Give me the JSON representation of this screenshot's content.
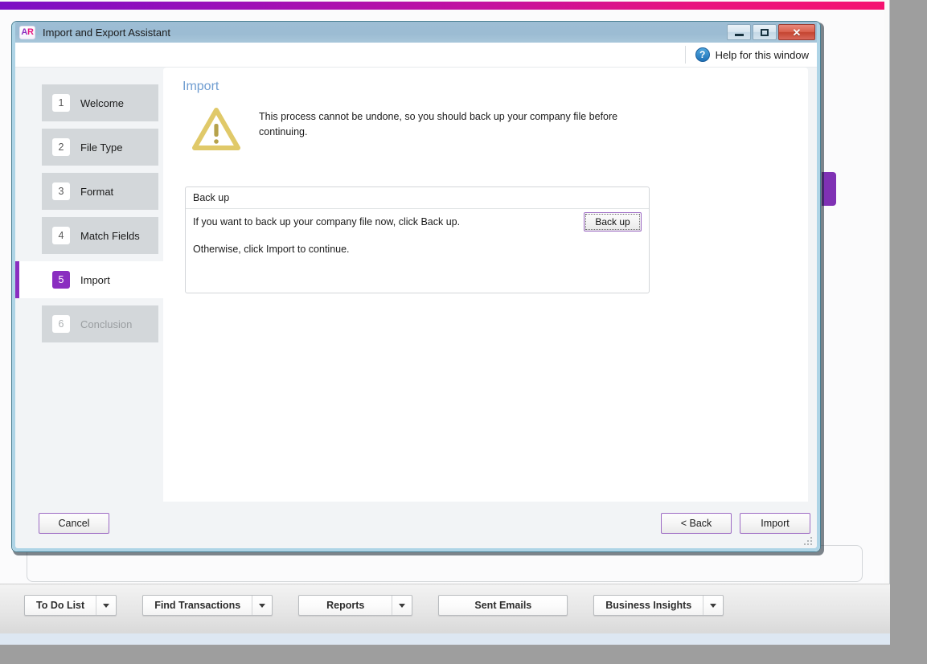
{
  "brand": {
    "gradient_start": "#7b0ec4",
    "gradient_end": "#f51271",
    "accent_purple": "#8a2ec0",
    "accent_pink": "#e5177f"
  },
  "dialog": {
    "logo": {
      "first": "A",
      "second": "R",
      "icon_name": "ar-logo-icon"
    },
    "title": "Import and Export Assistant",
    "window_controls": {
      "minimize": "minimize-icon",
      "maximize": "maximize-icon",
      "close": "✕"
    },
    "help": {
      "icon_glyph": "?",
      "label": "Help for this window"
    },
    "steps": [
      {
        "number": "1",
        "label": "Welcome",
        "state": "available"
      },
      {
        "number": "2",
        "label": "File Type",
        "state": "available"
      },
      {
        "number": "3",
        "label": "Format",
        "state": "available"
      },
      {
        "number": "4",
        "label": "Match Fields",
        "state": "available"
      },
      {
        "number": "5",
        "label": "Import",
        "state": "active"
      },
      {
        "number": "6",
        "label": "Conclusion",
        "state": "disabled"
      }
    ],
    "main": {
      "title": "Import",
      "warning": {
        "icon_name": "warning-triangle-icon",
        "icon_color": "#e0c969",
        "text": "This process cannot be undone, so you should back up your company file before continuing."
      },
      "groupbox": {
        "title": "Back up",
        "line1": "If you want to back up your company file now, click Back up.",
        "line2": "Otherwise, click Import to continue.",
        "button_label": "Back up"
      }
    },
    "footer": {
      "cancel_label": "Cancel",
      "back_label": "< Back",
      "import_label": "Import"
    }
  },
  "bottom_toolbar": {
    "buttons": [
      {
        "label": "To Do List",
        "has_dropdown": true
      },
      {
        "label": "Find Transactions",
        "has_dropdown": true
      },
      {
        "label": "Reports",
        "has_dropdown": true
      },
      {
        "label": "Sent Emails",
        "has_dropdown": false
      },
      {
        "label": "Business Insights",
        "has_dropdown": true
      }
    ]
  }
}
